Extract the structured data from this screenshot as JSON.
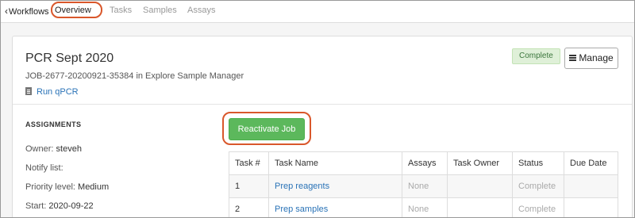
{
  "nav": {
    "back_label": "Workflows",
    "tabs": [
      {
        "label": "Overview",
        "active": true
      },
      {
        "label": "Tasks"
      },
      {
        "label": "Samples"
      },
      {
        "label": "Assays"
      }
    ]
  },
  "job": {
    "title": "PCR Sept 2020",
    "subtitle": "JOB-2677-20200921-35384 in Explore Sample Manager",
    "run_link": "Run qPCR",
    "status_badge": "Complete",
    "manage_label": "Manage"
  },
  "assignments": {
    "heading": "ASSIGNMENTS",
    "rows": [
      {
        "label": "Owner:",
        "value": "steveh"
      },
      {
        "label": "Notify list:",
        "value": ""
      },
      {
        "label": "Priority level:",
        "value": "Medium"
      },
      {
        "label": "Start:",
        "value": "2020-09-22"
      }
    ]
  },
  "actions": {
    "reactivate_label": "Reactivate Job"
  },
  "tasks_table": {
    "headers": [
      "Task #",
      "Task Name",
      "Assays",
      "Task Owner",
      "Status",
      "Due Date"
    ],
    "rows": [
      [
        "1",
        "Prep reagents",
        "None",
        "",
        "Complete",
        ""
      ],
      [
        "2",
        "Prep samples",
        "None",
        "",
        "Complete",
        ""
      ]
    ]
  },
  "colors": {
    "highlight": "#d9572b",
    "success": "#5cb85c",
    "link": "#2a73b7",
    "badge_bg": "#dff0d8"
  },
  "icons": [
    "chevron-left-icon",
    "document-icon",
    "menu-icon"
  ]
}
